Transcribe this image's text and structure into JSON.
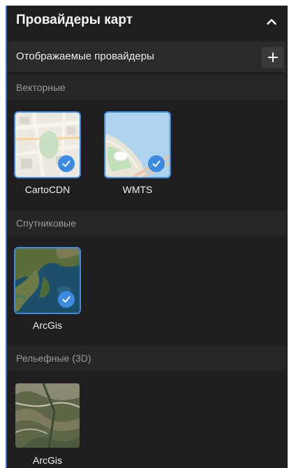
{
  "panel": {
    "title": "Провайдеры карт",
    "collapse_icon": "chevron-up-icon"
  },
  "displayed": {
    "title": "Отображаемые провайдеры",
    "add_icon": "plus-icon"
  },
  "sections": {
    "vector": {
      "label": "Векторные",
      "providers": [
        {
          "name": "CartoCDN",
          "selected": true
        },
        {
          "name": "WMTS",
          "selected": true
        }
      ]
    },
    "satellite": {
      "label": "Спутниковые",
      "providers": [
        {
          "name": "ArcGis",
          "selected": true
        }
      ]
    },
    "relief": {
      "label": "Рельефные (3D)",
      "providers": [
        {
          "name": "ArcGis",
          "selected": false
        }
      ]
    }
  },
  "colors": {
    "accent": "#3b8be0",
    "panel_bg": "#1f1f1f"
  }
}
